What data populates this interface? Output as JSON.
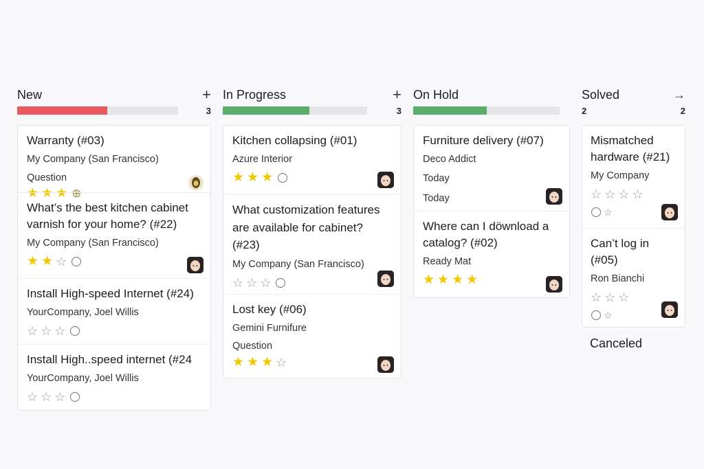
{
  "colors": {
    "new_bar": "#e85a60",
    "progress_bar": "#5aad6a",
    "star_on": "#f0c800"
  },
  "columns": [
    {
      "title": "New",
      "action_icon": "plus-icon",
      "action": "+",
      "progress": 0.56,
      "bar_color": "#e85a60",
      "count": "3",
      "cards": [
        {
          "title": "Warranty (#03)",
          "lines": [
            "My Company (San Francisco)",
            "Question"
          ],
          "stars": 3,
          "stars_total": 3,
          "extra": "circle-plus",
          "avatar": "gold-avatar"
        },
        {
          "title": "What’s the best kitchen cabinet varnish for your home? (#22)",
          "lines": [
            "My Company (San Francisco)"
          ],
          "stars": 2,
          "stars_total": 3,
          "extra": "circle",
          "avatar": "person-avatar"
        },
        {
          "title": "Install High-speed Internet (#24)",
          "lines": [
            "YourCompany, Joel Willis"
          ],
          "stars": 0,
          "stars_total": 3,
          "extra": "circle",
          "avatar": ""
        },
        {
          "title": "Install High..speed internet (#24",
          "lines": [
            "YourCompany, Joel Willis"
          ],
          "stars": 0,
          "stars_total": 3,
          "extra": "circle",
          "avatar": ""
        }
      ]
    },
    {
      "title": "In Progress",
      "action_icon": "plus-icon",
      "action": "+",
      "progress": 0.6,
      "bar_color": "#5aad6a",
      "count": "3",
      "cards": [
        {
          "title": "Kitchen collapsing (#01)",
          "lines": [
            "Azure Interior"
          ],
          "stars": 3,
          "stars_total": 3,
          "extra": "circle",
          "avatar": "person-avatar"
        },
        {
          "title": "What customization features are available for cabinet? (#23)",
          "lines": [
            "My Company (San Francisco)"
          ],
          "stars": 0,
          "stars_total": 3,
          "extra": "circle",
          "avatar": "person-avatar"
        },
        {
          "title": "Lost key (#06)",
          "lines": [
            "Gemini Furnifure",
            "Question"
          ],
          "stars": 3,
          "stars_total": 4,
          "extra": "",
          "avatar": "person-avatar"
        }
      ]
    },
    {
      "title": "On Hold",
      "action_icon": "",
      "action": "",
      "progress": 0.5,
      "bar_color": "#5aad6a",
      "count": "",
      "cards": [
        {
          "title": "Furniture delivery (#07)",
          "lines": [
            "Deco Addict",
            "Today",
            "Today"
          ],
          "stars": 0,
          "stars_total": 0,
          "extra": "",
          "avatar": "person-avatar"
        },
        {
          "title": "Where can I döwnload a catalog? (#02)",
          "lines": [
            "Ready Mat"
          ],
          "stars": 4,
          "stars_total": 4,
          "extra": "",
          "avatar": "person-avatar"
        }
      ]
    },
    {
      "title": "Solved",
      "action_icon": "arrow-right-icon",
      "action": "→",
      "progress": 0,
      "bar_color": "",
      "count_left": "2",
      "count": "2",
      "cards": [
        {
          "title": "Mismatched hardware (#21)",
          "lines": [
            "My Company"
          ],
          "stars": 0,
          "stars_total": 4,
          "extra": "circle-star",
          "avatar": "person-avatar"
        },
        {
          "title": "Can’t log in (#05)",
          "lines": [
            "Ron Bianchi"
          ],
          "stars": 0,
          "stars_total": 3,
          "extra": "circle-star",
          "avatar": "person-avatar"
        }
      ]
    }
  ],
  "canceled_label": "Canceled"
}
